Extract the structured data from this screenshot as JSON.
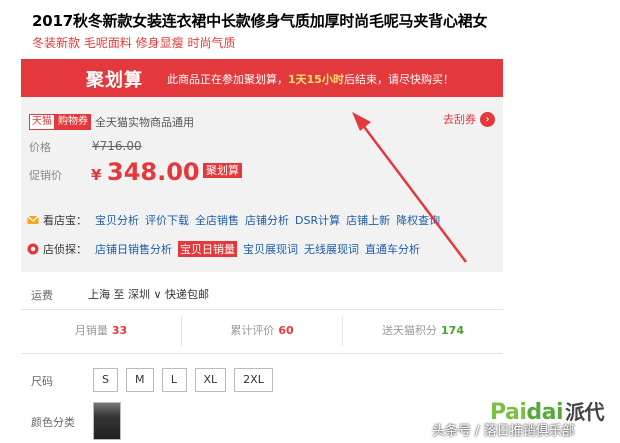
{
  "product": {
    "title": "2017秋冬新款女装连衣裙中长款修身气质加厚时尚毛呢马夹背心裙女",
    "subtitle": "冬装新款 毛呢面料 修身显瘦 时尚气质"
  },
  "banner": {
    "brand": "聚划算",
    "msg_before": "此商品正在参加聚划算，",
    "msg_highlight": "1天15小时",
    "msg_after": "后结束，请尽快购买！"
  },
  "coupon": {
    "tag_tmall": "天猫",
    "tag_cart": "购物券",
    "text": "全天猫实物商品通用",
    "link": "去刮券"
  },
  "price": {
    "orig_label": "价格",
    "orig_value": "¥716.00",
    "sale_label": "促销价",
    "sale_currency": "¥",
    "sale_value": "348.00",
    "sale_badge": "聚划算"
  },
  "tools_store": {
    "label": "看店宝：",
    "links": [
      "宝贝分析",
      "评价下载",
      "全店销售",
      "店铺分析",
      "DSR计算",
      "店铺上新",
      "降权查询"
    ]
  },
  "tools_detect": {
    "label": "店侦探：",
    "links": [
      "店铺日销售分析",
      "宝贝日销量",
      "宝贝展现词",
      "无线展现词",
      "直通车分析"
    ]
  },
  "shipping": {
    "label": "运费",
    "value": "上海 至 深圳 ∨ 快递包邮"
  },
  "stats": {
    "monthly_label": "月销量",
    "monthly_value": "33",
    "reviews_label": "累计评价",
    "reviews_value": "60",
    "points_label": "送天猫积分",
    "points_value": "174"
  },
  "sizes": {
    "label": "尺码",
    "options": [
      "S",
      "M",
      "L",
      "XL",
      "2XL"
    ]
  },
  "color": {
    "label": "颜色分类"
  },
  "watermark": {
    "brand_a": "Pai",
    "brand_b": "dai",
    "brand_cn": "派代",
    "caption": "头条号 / 落日推销俱乐部"
  },
  "colors": {
    "accent_red": "#e4393c",
    "link_blue": "#1e5ca8",
    "green": "#4aa02c"
  }
}
